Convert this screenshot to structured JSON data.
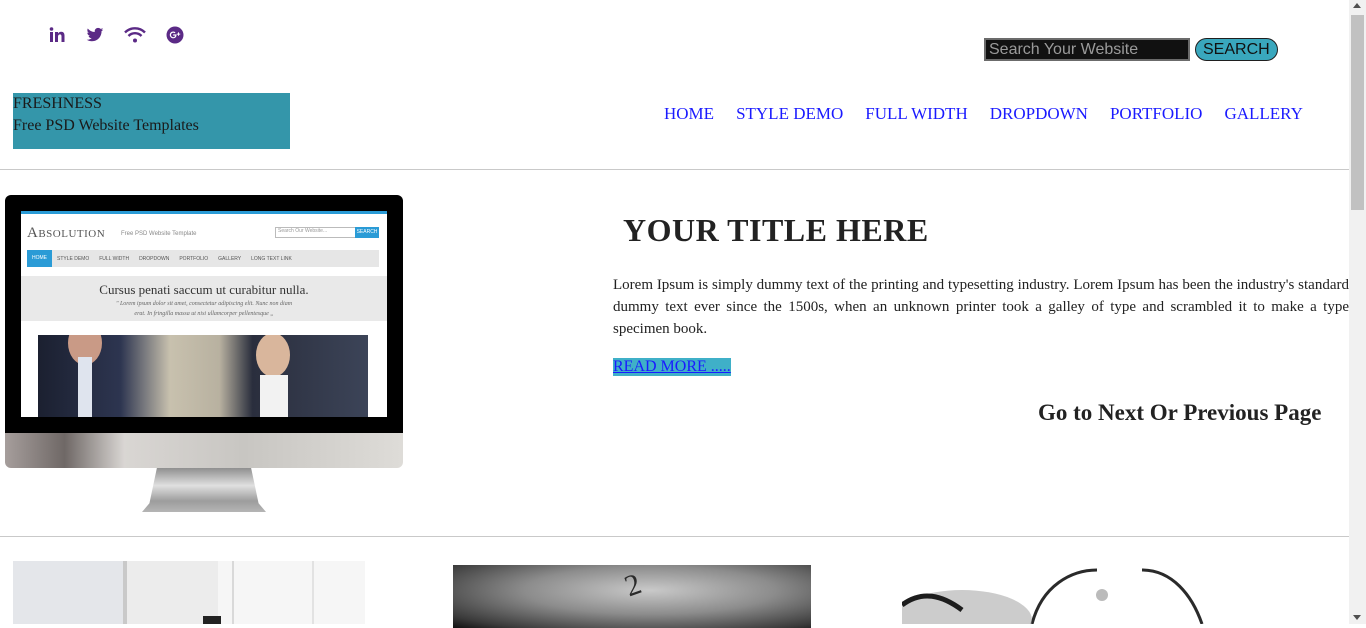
{
  "social": {
    "icons": [
      "linkedin-icon",
      "twitter-icon",
      "rss-wifi-icon",
      "google-plus-icon"
    ],
    "color": "#5b2a86"
  },
  "search": {
    "placeholder": "Search Your Website",
    "button_label": "SEARCH",
    "button_color": "#39a7bd"
  },
  "logo": {
    "title": "FRESHNESS",
    "subtitle": "Free PSD Website Templates",
    "bg_color": "#3496aa"
  },
  "nav": {
    "items": [
      "HOME",
      "STYLE DEMO",
      "FULL WIDTH",
      "DROPDOWN",
      "PORTFOLIO",
      "GALLERY"
    ],
    "link_color": "#1a1aff"
  },
  "monitor_screen": {
    "logo": "Absolution",
    "logo_sub": "Free PSD Website Template",
    "search_placeholder": "Search Our Website...",
    "search_button": "SEARCH",
    "nav": [
      "HOME",
      "STYLE DEMO",
      "FULL WIDTH",
      "DROPDOWN",
      "PORTFOLIO",
      "GALLERY",
      "LONG TEXT LINK"
    ],
    "banner_heading": "Cursus penati saccum ut curabitur nulla.",
    "banner_quote_line1": "\" Lorem ipsum dolor sit amet, consectetur adipiscing elit. Nunc non diam",
    "banner_quote_line2": "erat. In fringilla massa ut nisi ullamcorper pellentesque „"
  },
  "main": {
    "title": "YOUR TITLE HERE",
    "body": "Lorem Ipsum is simply dummy text of the printing and typesetting industry. Lorem Ipsum has been the industry's standard dummy text ever since the 1500s, when an unknown printer took a galley of type and scrambled it to make a type specimen book.",
    "read_more": "READ MORE .....",
    "read_more_bg": "#3fb0c8",
    "pager_heading": "Go to Next Or Previous Page"
  }
}
